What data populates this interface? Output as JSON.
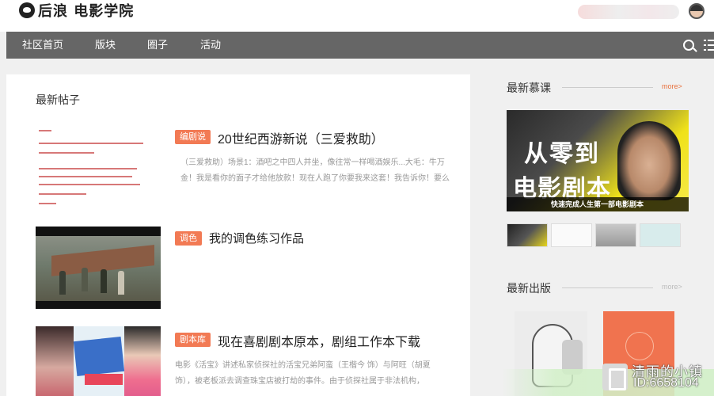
{
  "site": {
    "logo_text": "后浪 电影学院"
  },
  "nav": {
    "items": [
      "社区首页",
      "版块",
      "圈子",
      "活动"
    ]
  },
  "main": {
    "section_title": "最新帖子",
    "posts": [
      {
        "tag": "编剧说",
        "title": "20世纪西游新说（三爱救助）",
        "excerpt_line1": "（三爱救助）场景1：酒吧之中四人并坐，像往常一样喝酒娱乐...大毛：牛万",
        "excerpt_line2": "金！我是看你的面子才给他放款！现在人跑了你要我来这套！我告诉你！要么"
      },
      {
        "tag": "调色",
        "title": "我的调色练习作品"
      },
      {
        "tag": "剧本库",
        "title": "现在喜剧剧本原本，剧组工作本下载",
        "excerpt_line1": "电影《活宝》讲述私家侦探社的活宝兄弟阿蛮（王楷今 饰）与阿旺（胡夏",
        "excerpt_line2": "饰），被老板派去调查珠宝店被打劫的事件。由于侦探社属于非法机构，"
      }
    ]
  },
  "sidebar": {
    "courses": {
      "title": "最新慕课",
      "more": "more>",
      "banner_line1": "从零到",
      "banner_line2": "电影剧本",
      "banner_sub": "快速完成人生第一部电影剧本"
    },
    "publications": {
      "title": "最新出版",
      "more": "more>"
    }
  },
  "watermark": {
    "name": "清雨的小镇",
    "id": "ID:6658104"
  },
  "colors": {
    "nav_bg": "#666666",
    "tag_bg": "#f27a54",
    "more_link": "#e8703c",
    "page_bg": "#f0f0f0"
  },
  "icons": [
    "search-icon",
    "list-icon",
    "logo-icon",
    "avatar"
  ]
}
